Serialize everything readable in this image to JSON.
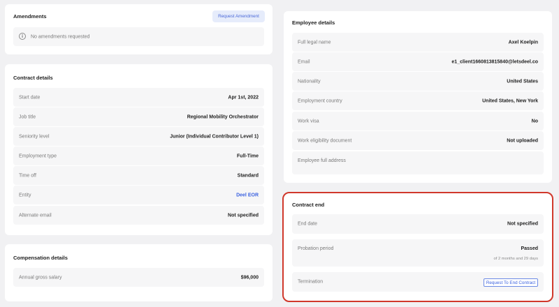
{
  "amendments": {
    "title": "Amendments",
    "request_button": "Request Amendment",
    "empty_text": "No amendments requested",
    "info_icon": "info-icon"
  },
  "contract_details": {
    "title": "Contract details",
    "rows": [
      {
        "label": "Start date",
        "value": "Apr 1st, 2022"
      },
      {
        "label": "Job title",
        "value": "Regional Mobility Orchestrator"
      },
      {
        "label": "Seniority level",
        "value": "Junior (Individual Contributor Level 1)"
      },
      {
        "label": "Employment type",
        "value": "Full-Time"
      },
      {
        "label": "Time off",
        "value": "Standard"
      },
      {
        "label": "Entity",
        "value": "Deel EOR"
      },
      {
        "label": "Alternate email",
        "value": "Not specified"
      }
    ]
  },
  "compensation": {
    "title": "Compensation details",
    "rows": [
      {
        "label": "Annual gross salary",
        "value": "$96,000"
      }
    ]
  },
  "employee_details": {
    "title": "Employee details",
    "rows": [
      {
        "label": "Full legal name",
        "value": "Axel Koelpin"
      },
      {
        "label": "Email",
        "value": "e1_client1660813815840@letsdeel.co"
      },
      {
        "label": "Nationality",
        "value": "United States"
      },
      {
        "label": "Employment country",
        "value": "United States, New York"
      },
      {
        "label": "Work visa",
        "value": "No"
      },
      {
        "label": "Work eligibility document",
        "value": "Not uploaded"
      },
      {
        "label": "Employee full address",
        "value": ""
      }
    ]
  },
  "contract_end": {
    "title": "Contract end",
    "end_date_label": "End date",
    "end_date_value": "Not specified",
    "probation_label": "Probation period",
    "probation_value": "Passed",
    "probation_note": "of 2 months and 29 days",
    "termination_label": "Termination",
    "termination_button": "Request To End Contract"
  },
  "colors": {
    "background": "#f1f1f3",
    "card": "#ffffff",
    "row": "#f6f6f7",
    "link": "#3b62e0",
    "highlight": "#d0382b"
  }
}
